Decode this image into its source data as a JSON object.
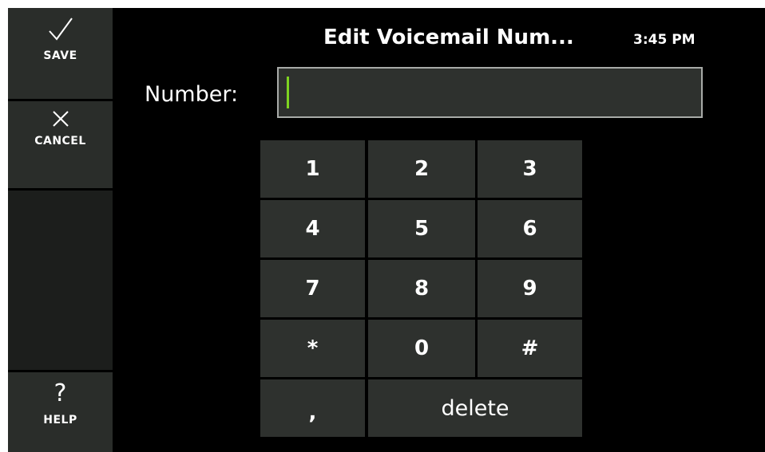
{
  "sidebar": {
    "save_label": "SAVE",
    "cancel_label": "CANCEL",
    "help_label": "HELP",
    "help_glyph": "?"
  },
  "header": {
    "title": "Edit Voicemail Num...",
    "time": "3:45 PM"
  },
  "number_field": {
    "label": "Number:",
    "value": ""
  },
  "keypad": {
    "k1": "1",
    "k2": "2",
    "k3": "3",
    "k4": "4",
    "k5": "5",
    "k6": "6",
    "k7": "7",
    "k8": "8",
    "k9": "9",
    "kstar": "*",
    "k0": "0",
    "khash": "#",
    "kcomma": ",",
    "delete": "delete"
  },
  "colors": {
    "background": "#000000",
    "button": "#2e312e",
    "cursor": "#7ed321",
    "text": "#ffffff"
  }
}
